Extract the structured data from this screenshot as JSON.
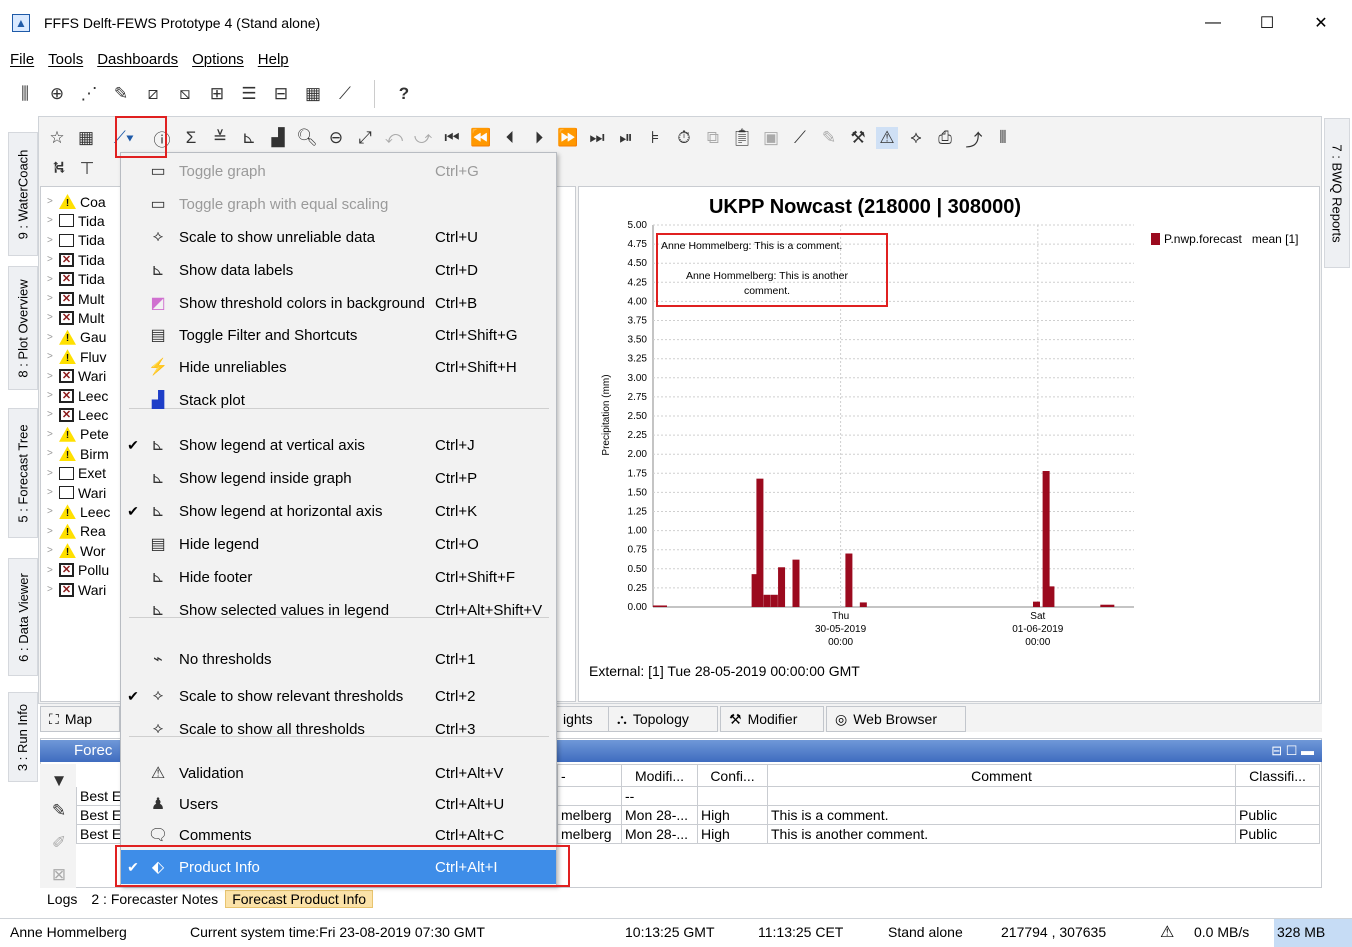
{
  "window": {
    "title": "FFFS Delft-FEWS Prototype 4  (Stand alone)",
    "minimize": "—",
    "maximize": "☐",
    "close": "✕"
  },
  "menubar": [
    "File",
    "Tools",
    "Dashboards",
    "Options",
    "Help"
  ],
  "toolbar_help": "?",
  "left_tabs": [
    "9 : WaterCoach",
    "8 : Plot Overview",
    "5 : Forecast Tree",
    "6 : Data Viewer",
    "3 : Run Info"
  ],
  "right_tab": "7 : BWQ Reports",
  "tree_items": [
    {
      "icon": "warning",
      "label": "Coa"
    },
    {
      "icon": "empty",
      "label": "Tida"
    },
    {
      "icon": "empty",
      "label": "Tida"
    },
    {
      "icon": "x",
      "label": "Tida"
    },
    {
      "icon": "x",
      "label": "Tida"
    },
    {
      "icon": "x",
      "label": "Mult"
    },
    {
      "icon": "x",
      "label": "Mult"
    },
    {
      "icon": "warning",
      "label": "Gau"
    },
    {
      "icon": "warning",
      "label": "Fluv"
    },
    {
      "icon": "x",
      "label": "Wari"
    },
    {
      "icon": "x",
      "label": "Leec"
    },
    {
      "icon": "x",
      "label": "Leec"
    },
    {
      "icon": "warning",
      "label": "Pete"
    },
    {
      "icon": "warning",
      "label": "Birm"
    },
    {
      "icon": "empty",
      "label": "Exet"
    },
    {
      "icon": "empty",
      "label": "Wari"
    },
    {
      "icon": "warning",
      "label": "Leec"
    },
    {
      "icon": "warning",
      "label": "Rea"
    },
    {
      "icon": "warning",
      "label": "Wor"
    },
    {
      "icon": "x",
      "label": "Pollu"
    },
    {
      "icon": "x",
      "label": "Wari"
    }
  ],
  "menu": [
    {
      "label": "Toggle graph",
      "shortcut": "Ctrl+G",
      "checked": false,
      "disabled": true,
      "icon": "graph-icon"
    },
    {
      "label": "Toggle graph with equal scaling",
      "shortcut": "",
      "checked": false,
      "disabled": true,
      "icon": "equal-scale-icon"
    },
    {
      "label": "Scale to show unreliable data",
      "shortcut": "Ctrl+U",
      "checked": false,
      "disabled": false,
      "icon": "scale-unreliable-icon"
    },
    {
      "label": "Show data labels",
      "shortcut": "Ctrl+D",
      "checked": false,
      "disabled": false,
      "icon": "data-labels-icon"
    },
    {
      "label": "Show threshold colors  in background",
      "shortcut": "Ctrl+B",
      "checked": false,
      "disabled": false,
      "icon": "threshold-colors-icon"
    },
    {
      "label": "Toggle Filter and Shortcuts",
      "shortcut": "Ctrl+Shift+G",
      "checked": false,
      "disabled": false,
      "icon": "filter-shortcuts-icon"
    },
    {
      "label": "Hide unreliables",
      "shortcut": "Ctrl+Shift+H",
      "checked": false,
      "disabled": false,
      "icon": "hide-unreliables-icon"
    },
    {
      "label": "Stack plot",
      "shortcut": "",
      "checked": false,
      "disabled": false,
      "icon": "stack-plot-icon"
    },
    {
      "label": "Show legend at vertical axis",
      "shortcut": "Ctrl+J",
      "checked": true,
      "disabled": false,
      "icon": "legend-vertical-icon"
    },
    {
      "label": "Show legend inside graph",
      "shortcut": "Ctrl+P",
      "checked": false,
      "disabled": false,
      "icon": "legend-inside-icon"
    },
    {
      "label": "Show legend at horizontal axis",
      "shortcut": "Ctrl+K",
      "checked": true,
      "disabled": false,
      "icon": "legend-horizontal-icon"
    },
    {
      "label": "Hide legend",
      "shortcut": "Ctrl+O",
      "checked": false,
      "disabled": false,
      "icon": "hide-legend-icon"
    },
    {
      "label": "Hide footer",
      "shortcut": "Ctrl+Shift+F",
      "checked": false,
      "disabled": false,
      "icon": "hide-footer-icon"
    },
    {
      "label": "Show selected values in legend",
      "shortcut": "Ctrl+Alt+Shift+V",
      "checked": false,
      "disabled": false,
      "icon": "selected-values-icon"
    },
    {
      "label": "No thresholds",
      "shortcut": "Ctrl+1",
      "checked": false,
      "disabled": false,
      "icon": "no-thresholds-icon"
    },
    {
      "label": "Scale to show relevant thresholds",
      "shortcut": "Ctrl+2",
      "checked": true,
      "disabled": false,
      "icon": "relevant-thresholds-icon"
    },
    {
      "label": "Scale to show all thresholds",
      "shortcut": "Ctrl+3",
      "checked": false,
      "disabled": false,
      "icon": "all-thresholds-icon"
    },
    {
      "label": "Validation",
      "shortcut": "Ctrl+Alt+V",
      "checked": false,
      "disabled": false,
      "icon": "validation-icon"
    },
    {
      "label": "Users",
      "shortcut": "Ctrl+Alt+U",
      "checked": false,
      "disabled": false,
      "icon": "users-icon"
    },
    {
      "label": "Comments",
      "shortcut": "Ctrl+Alt+C",
      "checked": false,
      "disabled": false,
      "icon": "comments-icon"
    },
    {
      "label": "Product Info",
      "shortcut": "Ctrl+Alt+I",
      "checked": true,
      "disabled": false,
      "selected": true,
      "icon": "tag-icon"
    }
  ],
  "chart_data": {
    "type": "bar",
    "title": "UKPP Nowcast (218000 | 308000)",
    "ylabel": "Precipitation (mm)",
    "xlabel": "",
    "ylim": [
      0,
      5
    ],
    "yticks": [
      "0.00",
      "0.25",
      "0.50",
      "0.75",
      "1.00",
      "1.25",
      "1.50",
      "1.75",
      "2.00",
      "2.25",
      "2.50",
      "2.75",
      "3.00",
      "3.25",
      "3.50",
      "3.75",
      "4.00",
      "4.25",
      "4.50",
      "4.75",
      "5.00"
    ],
    "xticks": [
      {
        "day": "Thu",
        "date": "30-05-2019",
        "time": "00:00"
      },
      {
        "day": "Sat",
        "date": "01-06-2019",
        "time": "00:00"
      }
    ],
    "legend": "P.nwp.forecast   mean [1]",
    "legend_color": "#9b0a1e",
    "series_color": "#9b0a1e",
    "bars": [
      {
        "x": 0.0,
        "y": 0.02
      },
      {
        "x": 0.205,
        "y": 0.43
      },
      {
        "x": 0.215,
        "y": 1.68
      },
      {
        "x": 0.23,
        "y": 0.16
      },
      {
        "x": 0.245,
        "y": 0.16
      },
      {
        "x": 0.26,
        "y": 0.52
      },
      {
        "x": 0.29,
        "y": 0.62
      },
      {
        "x": 0.4,
        "y": 0.7
      },
      {
        "x": 0.43,
        "y": 0.06
      },
      {
        "x": 0.79,
        "y": 0.07
      },
      {
        "x": 0.81,
        "y": 1.78
      },
      {
        "x": 0.82,
        "y": 0.27
      },
      {
        "x": 0.93,
        "y": 0.03
      }
    ],
    "comments": [
      "Anne Hommelberg: This is a comment.",
      "Anne Hommelberg: This is another comment."
    ],
    "footer": "External: [1] Tue 28-05-2019 00:00:00 GMT"
  },
  "bottom_tabs": [
    "Map",
    "ights",
    "Topology",
    "Modifier",
    "Web Browser"
  ],
  "product_panel": {
    "title": "Forec",
    "columns": [
      "Modifi...",
      "Confi...",
      "Comment",
      "Classifi..."
    ],
    "rows": [
      {
        "name": "Best E",
        "user": "",
        "modified": "--",
        "confidence": "",
        "comment": "",
        "classification": ""
      },
      {
        "name": "Best E",
        "user": "melberg",
        "modified": "Mon 28-...",
        "confidence": "High",
        "comment": "This is a comment.",
        "classification": "Public"
      },
      {
        "name": "Best E",
        "user": "melberg",
        "modified": "Mon 28-...",
        "confidence": "High",
        "comment": "This is another comment.",
        "classification": "Public"
      }
    ]
  },
  "lower_tabs": [
    "Logs",
    "2 : Forecaster Notes",
    "Forecast Product Info"
  ],
  "status": {
    "user": "Anne Hommelberg",
    "systime": "Current system time:Fri 23-08-2019 07:30 GMT",
    "gmt": "10:13:25 GMT",
    "cet": "11:13:25 CET",
    "mode": "Stand alone",
    "coords": "217794 , 307635",
    "rate": "0.0 MB/s",
    "mem": "328 MB"
  }
}
